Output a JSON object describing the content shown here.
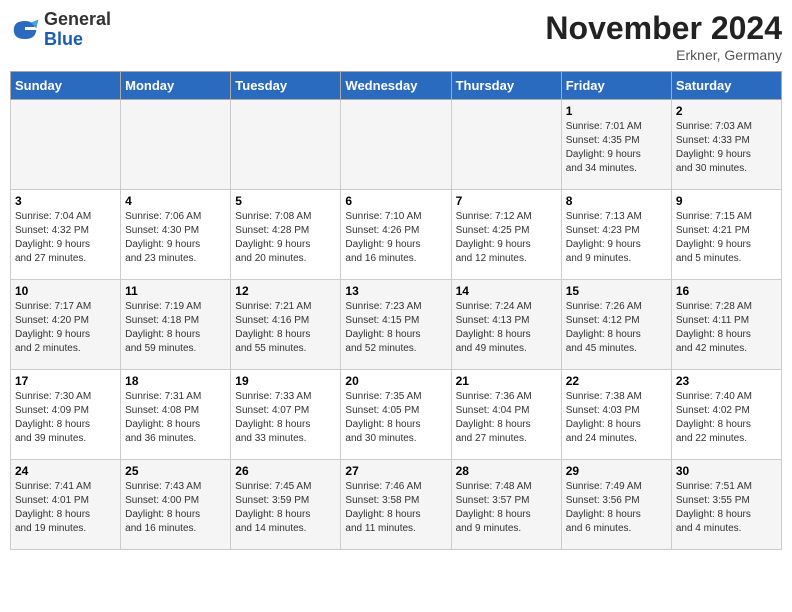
{
  "header": {
    "logo_general": "General",
    "logo_blue": "Blue",
    "month_title": "November 2024",
    "location": "Erkner, Germany"
  },
  "weekdays": [
    "Sunday",
    "Monday",
    "Tuesday",
    "Wednesday",
    "Thursday",
    "Friday",
    "Saturday"
  ],
  "rows": [
    [
      {
        "day": "",
        "info": ""
      },
      {
        "day": "",
        "info": ""
      },
      {
        "day": "",
        "info": ""
      },
      {
        "day": "",
        "info": ""
      },
      {
        "day": "",
        "info": ""
      },
      {
        "day": "1",
        "info": "Sunrise: 7:01 AM\nSunset: 4:35 PM\nDaylight: 9 hours\nand 34 minutes."
      },
      {
        "day": "2",
        "info": "Sunrise: 7:03 AM\nSunset: 4:33 PM\nDaylight: 9 hours\nand 30 minutes."
      }
    ],
    [
      {
        "day": "3",
        "info": "Sunrise: 7:04 AM\nSunset: 4:32 PM\nDaylight: 9 hours\nand 27 minutes."
      },
      {
        "day": "4",
        "info": "Sunrise: 7:06 AM\nSunset: 4:30 PM\nDaylight: 9 hours\nand 23 minutes."
      },
      {
        "day": "5",
        "info": "Sunrise: 7:08 AM\nSunset: 4:28 PM\nDaylight: 9 hours\nand 20 minutes."
      },
      {
        "day": "6",
        "info": "Sunrise: 7:10 AM\nSunset: 4:26 PM\nDaylight: 9 hours\nand 16 minutes."
      },
      {
        "day": "7",
        "info": "Sunrise: 7:12 AM\nSunset: 4:25 PM\nDaylight: 9 hours\nand 12 minutes."
      },
      {
        "day": "8",
        "info": "Sunrise: 7:13 AM\nSunset: 4:23 PM\nDaylight: 9 hours\nand 9 minutes."
      },
      {
        "day": "9",
        "info": "Sunrise: 7:15 AM\nSunset: 4:21 PM\nDaylight: 9 hours\nand 5 minutes."
      }
    ],
    [
      {
        "day": "10",
        "info": "Sunrise: 7:17 AM\nSunset: 4:20 PM\nDaylight: 9 hours\nand 2 minutes."
      },
      {
        "day": "11",
        "info": "Sunrise: 7:19 AM\nSunset: 4:18 PM\nDaylight: 8 hours\nand 59 minutes."
      },
      {
        "day": "12",
        "info": "Sunrise: 7:21 AM\nSunset: 4:16 PM\nDaylight: 8 hours\nand 55 minutes."
      },
      {
        "day": "13",
        "info": "Sunrise: 7:23 AM\nSunset: 4:15 PM\nDaylight: 8 hours\nand 52 minutes."
      },
      {
        "day": "14",
        "info": "Sunrise: 7:24 AM\nSunset: 4:13 PM\nDaylight: 8 hours\nand 49 minutes."
      },
      {
        "day": "15",
        "info": "Sunrise: 7:26 AM\nSunset: 4:12 PM\nDaylight: 8 hours\nand 45 minutes."
      },
      {
        "day": "16",
        "info": "Sunrise: 7:28 AM\nSunset: 4:11 PM\nDaylight: 8 hours\nand 42 minutes."
      }
    ],
    [
      {
        "day": "17",
        "info": "Sunrise: 7:30 AM\nSunset: 4:09 PM\nDaylight: 8 hours\nand 39 minutes."
      },
      {
        "day": "18",
        "info": "Sunrise: 7:31 AM\nSunset: 4:08 PM\nDaylight: 8 hours\nand 36 minutes."
      },
      {
        "day": "19",
        "info": "Sunrise: 7:33 AM\nSunset: 4:07 PM\nDaylight: 8 hours\nand 33 minutes."
      },
      {
        "day": "20",
        "info": "Sunrise: 7:35 AM\nSunset: 4:05 PM\nDaylight: 8 hours\nand 30 minutes."
      },
      {
        "day": "21",
        "info": "Sunrise: 7:36 AM\nSunset: 4:04 PM\nDaylight: 8 hours\nand 27 minutes."
      },
      {
        "day": "22",
        "info": "Sunrise: 7:38 AM\nSunset: 4:03 PM\nDaylight: 8 hours\nand 24 minutes."
      },
      {
        "day": "23",
        "info": "Sunrise: 7:40 AM\nSunset: 4:02 PM\nDaylight: 8 hours\nand 22 minutes."
      }
    ],
    [
      {
        "day": "24",
        "info": "Sunrise: 7:41 AM\nSunset: 4:01 PM\nDaylight: 8 hours\nand 19 minutes."
      },
      {
        "day": "25",
        "info": "Sunrise: 7:43 AM\nSunset: 4:00 PM\nDaylight: 8 hours\nand 16 minutes."
      },
      {
        "day": "26",
        "info": "Sunrise: 7:45 AM\nSunset: 3:59 PM\nDaylight: 8 hours\nand 14 minutes."
      },
      {
        "day": "27",
        "info": "Sunrise: 7:46 AM\nSunset: 3:58 PM\nDaylight: 8 hours\nand 11 minutes."
      },
      {
        "day": "28",
        "info": "Sunrise: 7:48 AM\nSunset: 3:57 PM\nDaylight: 8 hours\nand 9 minutes."
      },
      {
        "day": "29",
        "info": "Sunrise: 7:49 AM\nSunset: 3:56 PM\nDaylight: 8 hours\nand 6 minutes."
      },
      {
        "day": "30",
        "info": "Sunrise: 7:51 AM\nSunset: 3:55 PM\nDaylight: 8 hours\nand 4 minutes."
      }
    ]
  ]
}
